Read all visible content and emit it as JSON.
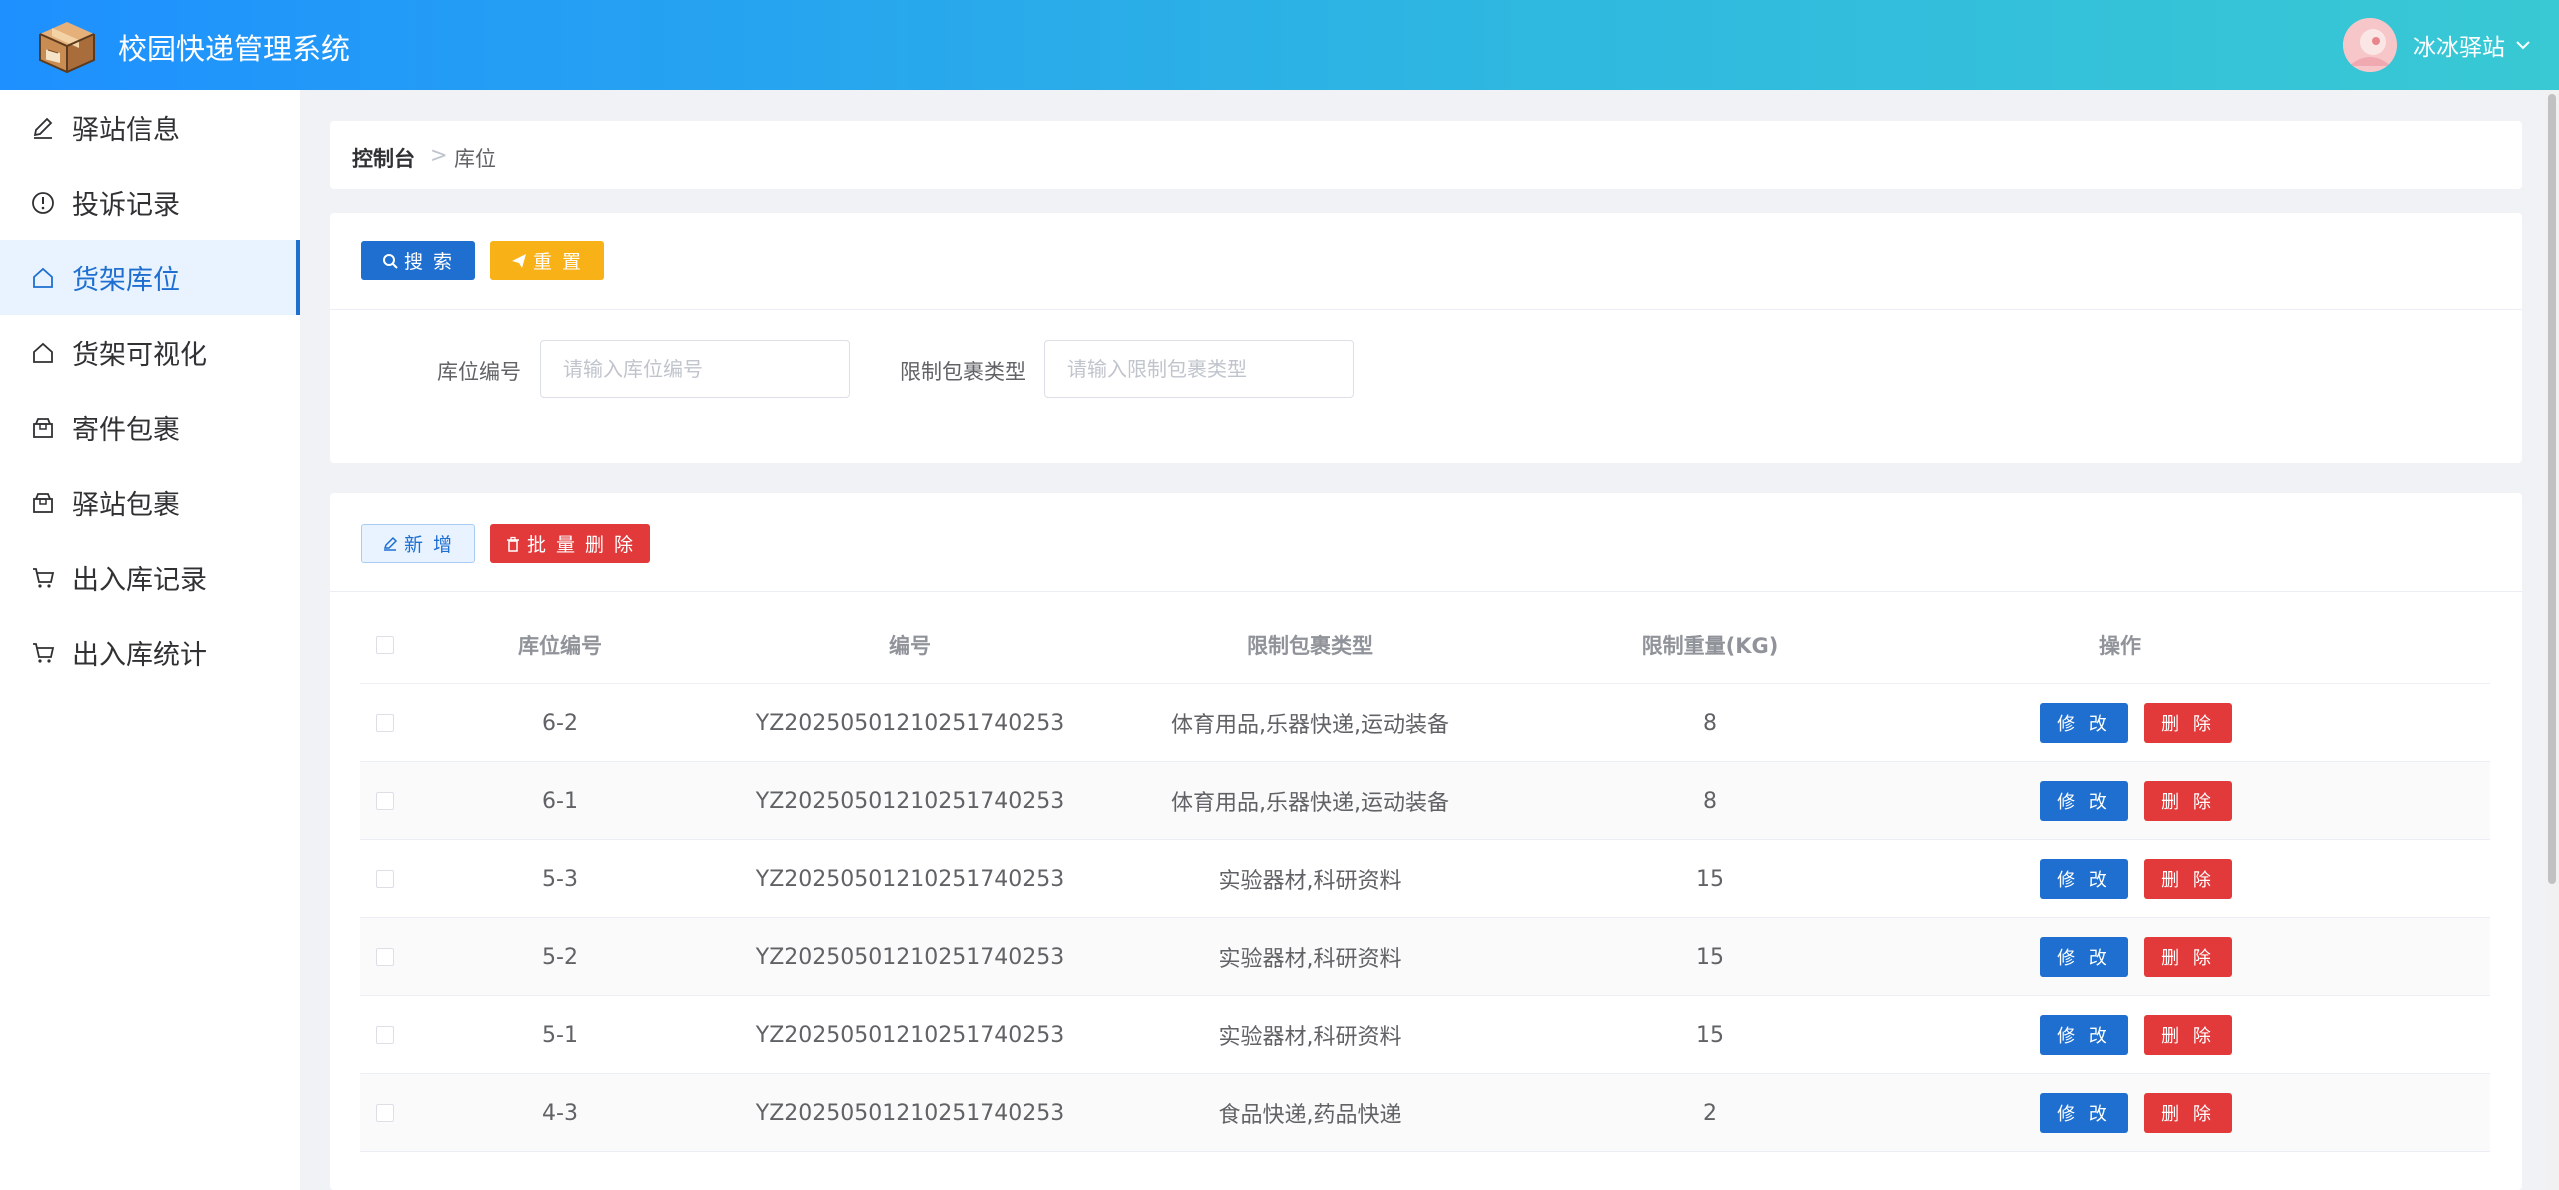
{
  "header": {
    "title": "校园快递管理系统",
    "user_name": "冰冰驿站"
  },
  "sidebar": {
    "items": [
      {
        "label": "驿站信息",
        "icon": "edit-icon"
      },
      {
        "label": "投诉记录",
        "icon": "warning-icon"
      },
      {
        "label": "货架库位",
        "icon": "house-icon",
        "active": true
      },
      {
        "label": "货架可视化",
        "icon": "house-icon"
      },
      {
        "label": "寄件包裹",
        "icon": "package-icon"
      },
      {
        "label": "驿站包裹",
        "icon": "package-icon"
      },
      {
        "label": "出入库记录",
        "icon": "cart-icon"
      },
      {
        "label": "出入库统计",
        "icon": "cart-icon"
      }
    ]
  },
  "breadcrumb": {
    "home": "控制台",
    "separator": ">",
    "current": "库位"
  },
  "search": {
    "search_label": "搜 索",
    "reset_label": "重 置",
    "fields": [
      {
        "label": "库位编号",
        "placeholder": "请输入库位编号",
        "value": ""
      },
      {
        "label": "限制包裹类型",
        "placeholder": "请输入限制包裹类型",
        "value": ""
      }
    ]
  },
  "toolbar": {
    "add_label": "新 增",
    "batch_delete_label": "批 量 删 除"
  },
  "table": {
    "columns": [
      "库位编号",
      "编号",
      "限制包裹类型",
      "限制重量(KG)",
      "操作"
    ],
    "edit_label": "修 改",
    "delete_label": "删 除",
    "rows": [
      {
        "slot": "6-2",
        "code": "YZ20250501210251740253",
        "types": "体育用品,乐器快递,运动装备",
        "weight": "8"
      },
      {
        "slot": "6-1",
        "code": "YZ20250501210251740253",
        "types": "体育用品,乐器快递,运动装备",
        "weight": "8"
      },
      {
        "slot": "5-3",
        "code": "YZ20250501210251740253",
        "types": "实验器材,科研资料",
        "weight": "15"
      },
      {
        "slot": "5-2",
        "code": "YZ20250501210251740253",
        "types": "实验器材,科研资料",
        "weight": "15"
      },
      {
        "slot": "5-1",
        "code": "YZ20250501210251740253",
        "types": "实验器材,科研资料",
        "weight": "15"
      },
      {
        "slot": "4-3",
        "code": "YZ20250501210251740253",
        "types": "食品快递,药品快递",
        "weight": "2"
      }
    ]
  },
  "colors": {
    "primary": "#1e6fd0",
    "warning": "#f8b116",
    "danger": "#e23a3a",
    "header_gradient_start": "#1e90ff",
    "header_gradient_end": "#38c9d4"
  }
}
